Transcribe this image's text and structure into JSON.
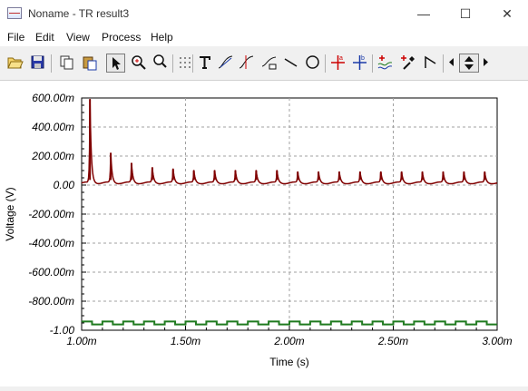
{
  "window": {
    "title": "Noname - TR result3",
    "controls": {
      "minimize": "—",
      "maximize": "☐",
      "close": "✕"
    }
  },
  "menu": [
    "File",
    "Edit",
    "View",
    "Process",
    "Help"
  ],
  "toolbar": {
    "buttons": [
      "open-folder-icon",
      "save-icon",
      "copy-icon",
      "paste-icon",
      "pointer-icon",
      "zoom-in-icon",
      "zoom-100-icon",
      "grid-icon",
      "text-icon",
      "tangent-icon",
      "cursor-icon",
      "area-icon",
      "line-icon",
      "circle-icon",
      "cursor-a-icon",
      "cursor-b-icon",
      "add-curve-icon",
      "add-marker-icon",
      "spline-icon",
      "scroll-left-icon",
      "scroll-updown-icon",
      "scroll-right-icon"
    ],
    "selected": "pointer-icon"
  },
  "chart_data": {
    "type": "line",
    "xlabel": "Time (s)",
    "ylabel": "Voltage (V)",
    "xlim": [
      0.001,
      0.003
    ],
    "ylim": [
      -1.0,
      0.6
    ],
    "x_ticks": [
      0.001,
      0.0015,
      0.002,
      0.0025,
      0.003
    ],
    "x_tick_labels": [
      "1.00m",
      "1.50m",
      "2.00m",
      "2.50m",
      "3.00m"
    ],
    "y_ticks": [
      0.6,
      0.4,
      0.2,
      0.0,
      -0.2,
      -0.4,
      -0.6,
      -0.8,
      -1.0
    ],
    "y_tick_labels": [
      "600.00m",
      "400.00m",
      "200.00m",
      "0.00",
      "-200.00m",
      "-400.00m",
      "-600.00m",
      "-800.00m",
      "-1.00"
    ],
    "grid": true,
    "series": [
      {
        "color": "#800000",
        "baseline": 0.015,
        "spike_times": [
          0.00104,
          0.00114,
          0.00124,
          0.00134,
          0.00144,
          0.00154,
          0.00164,
          0.00174,
          0.00184,
          0.00194,
          0.00204,
          0.00214,
          0.00224,
          0.00234,
          0.00244,
          0.00254,
          0.00264,
          0.00274,
          0.00284,
          0.00294
        ],
        "spike_peaks": [
          0.59,
          0.22,
          0.15,
          0.12,
          0.11,
          0.1,
          0.1,
          0.1,
          0.1,
          0.1,
          0.09,
          0.09,
          0.09,
          0.09,
          0.09,
          0.09,
          0.09,
          0.09,
          0.09,
          0.09
        ]
      },
      {
        "color": "#1f7a1f",
        "type": "square",
        "period": 0.0001,
        "low": -0.96,
        "high": -0.94
      }
    ]
  }
}
